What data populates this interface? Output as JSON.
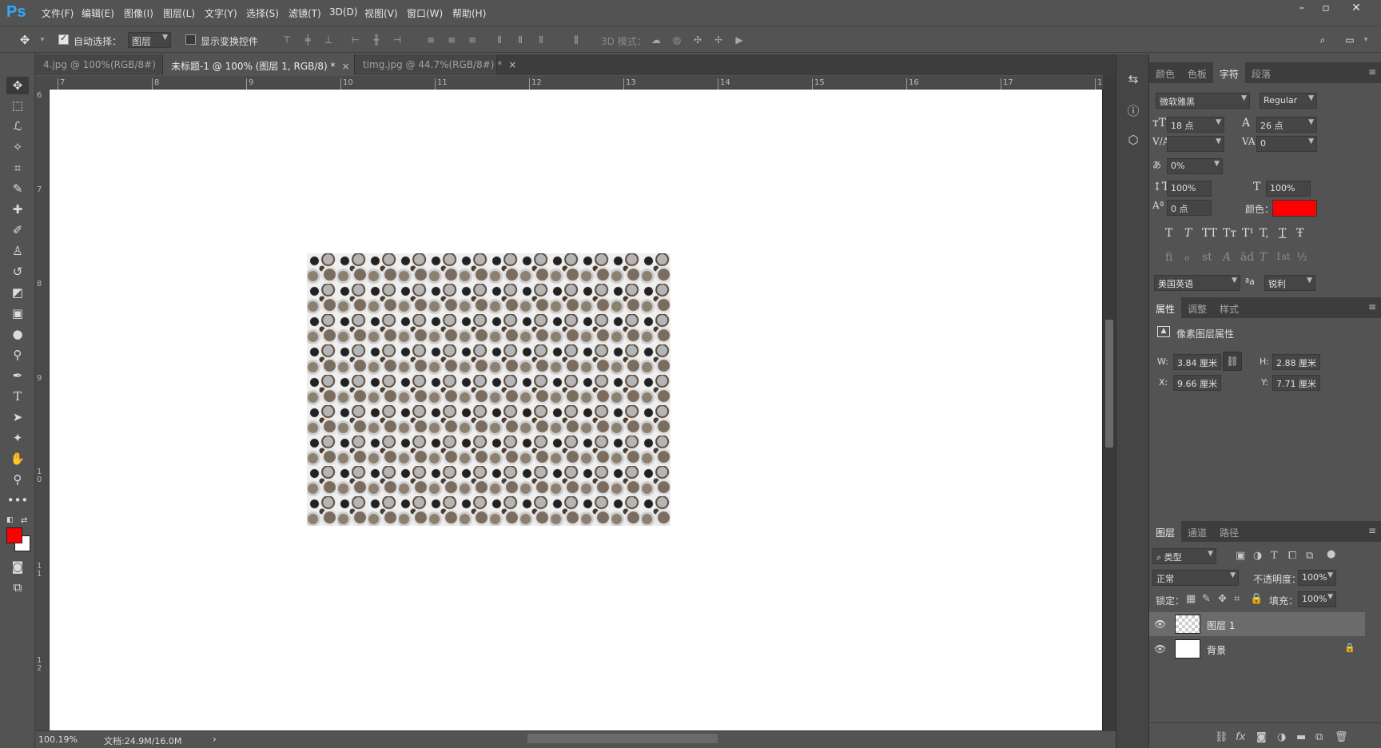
{
  "app": {
    "logo": "Ps"
  },
  "menu": [
    "文件(F)",
    "编辑(E)",
    "图像(I)",
    "图层(L)",
    "文字(Y)",
    "选择(S)",
    "滤镜(T)",
    "3D(D)",
    "视图(V)",
    "窗口(W)",
    "帮助(H)"
  ],
  "window_controls": {
    "minimize": "–",
    "maximize": "▫",
    "close": "✕"
  },
  "options": {
    "auto_select_label": "自动选择：",
    "auto_select_checked": true,
    "auto_select_target": "图层",
    "show_transform_label": "显示变换控件",
    "mode_3d_label": "3D 模式："
  },
  "tabs": [
    {
      "label": "4.jpg @ 100%(RGB/8#)",
      "close": "×"
    },
    {
      "label": "未标题-1 @ 100% (图层 1, RGB/8) *",
      "close": "×",
      "active": true
    },
    {
      "label": "timg.jpg @ 44.7%(RGB/8#) *",
      "close": "×"
    }
  ],
  "ruler_top": [
    "7",
    "8",
    "9",
    "10",
    "11",
    "12",
    "13",
    "14",
    "15",
    "16",
    "17",
    "1"
  ],
  "ruler_left": [
    "6",
    "7",
    "8",
    "9",
    "1\n0",
    "1\n1",
    "1\n2"
  ],
  "status": {
    "zoom": "100.19%",
    "doc": "文档:24.9M/16.0M",
    "arrow": "›"
  },
  "tool_icons": [
    "move-icon",
    "marquee-icon",
    "lasso-icon",
    "magic-wand-icon",
    "crop-icon",
    "eyedropper-icon",
    "healing-icon",
    "brush-icon",
    "stamp-icon",
    "history-brush-icon",
    "eraser-icon",
    "gradient-icon",
    "blur-icon",
    "dodge-icon",
    "pen-icon",
    "type-icon",
    "path-select-icon",
    "shape-icon",
    "hand-icon",
    "zoom-icon",
    "more-icon"
  ],
  "colors": {
    "foreground": "#ff0000",
    "background": "#ffffff",
    "text_color_swatch": "#ff0000",
    "accent": "#31a8ff"
  },
  "character_panel": {
    "tabs": [
      "颜色",
      "色板",
      "字符",
      "段落"
    ],
    "active_tab": "字符",
    "font_family": "微软雅黑",
    "font_style": "Regular",
    "font_size": "18 点",
    "leading": "26 点",
    "kerning": "",
    "tracking": "0",
    "scale_percent": "0%",
    "vertical_scale": "100%",
    "horizontal_scale": "100%",
    "baseline_shift": "0 点",
    "color_label": "颜色：",
    "style_buttons": [
      "T",
      "T",
      "TT",
      "Tт",
      "T¹",
      "T,",
      "T",
      "Ŧ"
    ],
    "opentype_buttons": [
      "fi",
      "ℴ",
      "st",
      "A",
      "ād",
      "T",
      "1st",
      "½"
    ],
    "language": "美国英语",
    "aa_label": "ªa",
    "antialias": "锐利"
  },
  "properties_panel": {
    "tabs": [
      "属性",
      "调整",
      "样式"
    ],
    "active_tab": "属性",
    "title": "像素图层属性",
    "w_label": "W:",
    "w": "3.84 厘米",
    "h_label": "H:",
    "h": "2.88 厘米",
    "x_label": "X:",
    "x": "9.66 厘米",
    "y_label": "Y:",
    "y": "7.71 厘米"
  },
  "layers_panel": {
    "tabs": [
      "图层",
      "通道",
      "路径"
    ],
    "active_tab": "图层",
    "filter": "类型",
    "blend_mode": "正常",
    "opacity_label": "不透明度：",
    "opacity": "100%",
    "lock_label": "锁定：",
    "fill_label": "填充：",
    "fill": "100%",
    "layers": [
      {
        "name": "图层 1",
        "selected": true
      },
      {
        "name": "背景",
        "locked": true
      }
    ]
  }
}
